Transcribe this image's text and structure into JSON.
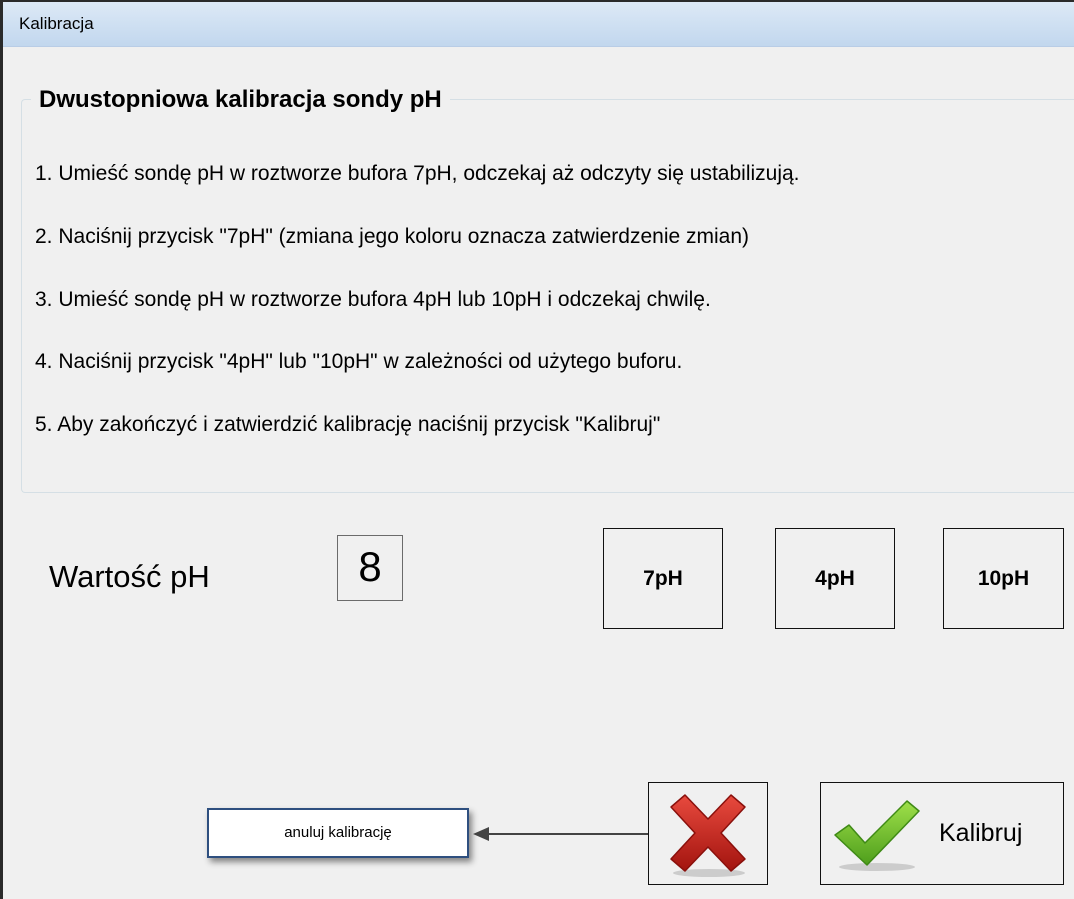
{
  "window": {
    "title": "Kalibracja"
  },
  "group": {
    "title": "Dwustopniowa kalibracja sondy pH",
    "steps": [
      "1. Umieść sondę pH w roztworze bufora 7pH, odczekaj aż odczyty się ustabilizują.",
      "2. Naciśnij przycisk \"7pH\" (zmiana jego koloru oznacza zatwierdzenie zmian)",
      "3. Umieść sondę pH w roztworze bufora 4pH lub 10pH i odczekaj chwilę.",
      "4. Naciśnij przycisk \"4pH\" lub \"10pH\" w zależności od użytego buforu.",
      "5. Aby zakończyć i zatwierdzić kalibrację naciśnij przycisk \"Kalibruj\""
    ]
  },
  "reading": {
    "label": "Wartość pH",
    "value": "8"
  },
  "buffers": {
    "ph7_label": "7pH",
    "ph4_label": "4pH",
    "ph10_label": "10pH"
  },
  "actions": {
    "cancel_icon": "red-x-icon",
    "confirm_icon": "green-check-icon",
    "confirm_label": "Kalibruj"
  },
  "tooltip": {
    "text": "anuluj kalibrację"
  },
  "colors": {
    "titlebar": "#cfe0f2",
    "background": "#f0f0f0",
    "cancel_red": "#c8201d",
    "check_green": "#7cc832"
  }
}
